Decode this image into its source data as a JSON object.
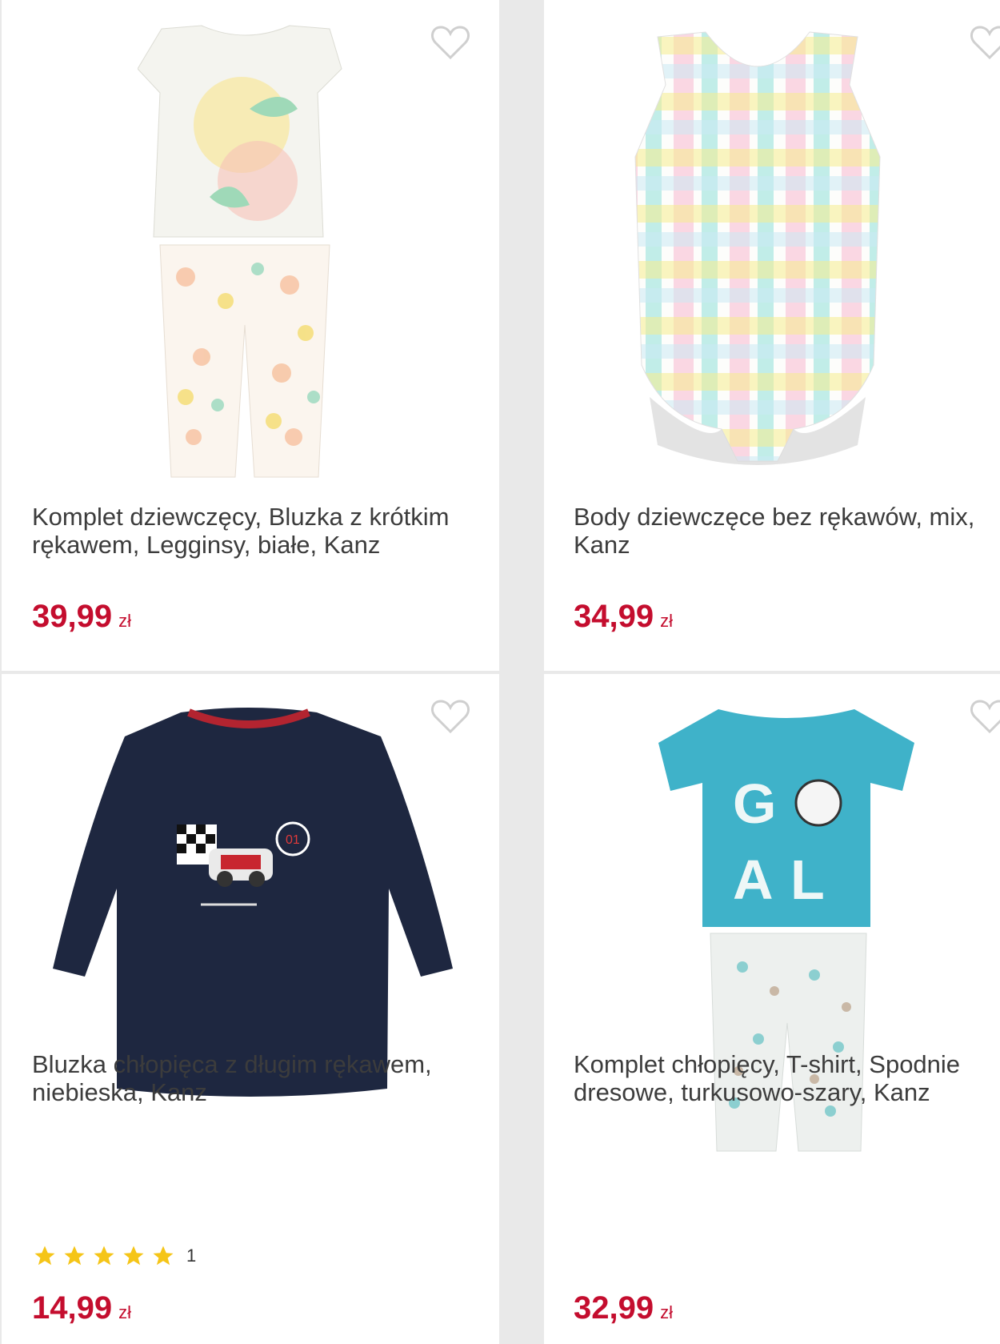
{
  "products": [
    {
      "title": "Komplet dziewczęcy, Bluzka z krótkim rękawem, Legginsy, białe, Kanz",
      "price": "39,99",
      "currency": "zł"
    },
    {
      "title": "Body dziewczęce bez rękawów, mix, Kanz",
      "price": "34,99",
      "currency": "zł"
    },
    {
      "title": "Bluzka chłopięca z długim rękawem, niebieska, Kanz",
      "price": "14,99",
      "currency": "zł",
      "rating": {
        "stars": 5,
        "count": "1"
      }
    },
    {
      "title": "Komplet chłopięcy, T-shirt, Spodnie dresowe, turkusowo-szary, Kanz",
      "price": "32,99",
      "currency": "zł"
    }
  ],
  "icons": {
    "favorite": "heart-outline-icon",
    "rating": "star-icon"
  },
  "colors": {
    "price": "#c40d2e",
    "star": "#f5c518",
    "heart": "#cfcfcf"
  }
}
